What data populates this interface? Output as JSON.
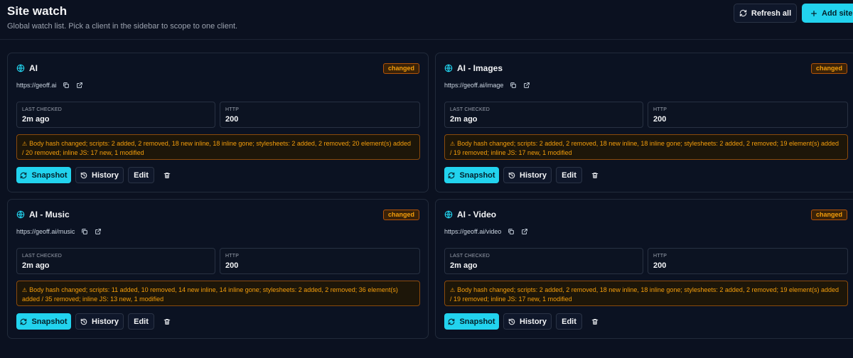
{
  "header": {
    "title": "Site watch",
    "subtitle": "Global watch list. Pick a client in the sidebar to scope to one client.",
    "refresh_label": "Refresh all",
    "add_label": "Add site"
  },
  "labels": {
    "last_checked": "LAST CHECKED",
    "http": "HTTP",
    "snapshot": "Snapshot",
    "history": "History",
    "edit": "Edit"
  },
  "colors": {
    "accent": "#22d3ee",
    "warning": "#f59e0b",
    "background": "#0b1120"
  },
  "sites": [
    {
      "name": "AI",
      "url": "https://geoff.ai",
      "badge": "changed",
      "last_checked": "2m ago",
      "http": "200",
      "warning": "Body hash changed; scripts: 2 added, 2 removed, 18 new inline, 18 inline gone; stylesheets: 2 added, 2 removed; 20 element(s) added / 20 removed; inline JS: 17 new, 1 modified"
    },
    {
      "name": "AI - Images",
      "url": "https://geoff.ai/image",
      "badge": "changed",
      "last_checked": "2m ago",
      "http": "200",
      "warning": "Body hash changed; scripts: 2 added, 2 removed, 18 new inline, 18 inline gone; stylesheets: 2 added, 2 removed; 19 element(s) added / 19 removed; inline JS: 17 new, 1 modified"
    },
    {
      "name": "AI - Music",
      "url": "https://geoff.ai/music",
      "badge": "changed",
      "last_checked": "2m ago",
      "http": "200",
      "warning": "Body hash changed; scripts: 11 added, 10 removed, 14 new inline, 14 inline gone; stylesheets: 2 added, 2 removed; 36 element(s) added / 35 removed; inline JS: 13 new, 1 modified"
    },
    {
      "name": "AI - Video",
      "url": "https://geoff.ai/video",
      "badge": "changed",
      "last_checked": "2m ago",
      "http": "200",
      "warning": "Body hash changed; scripts: 2 added, 2 removed, 18 new inline, 18 inline gone; stylesheets: 2 added, 2 removed; 19 element(s) added / 19 removed; inline JS: 17 new, 1 modified"
    }
  ]
}
